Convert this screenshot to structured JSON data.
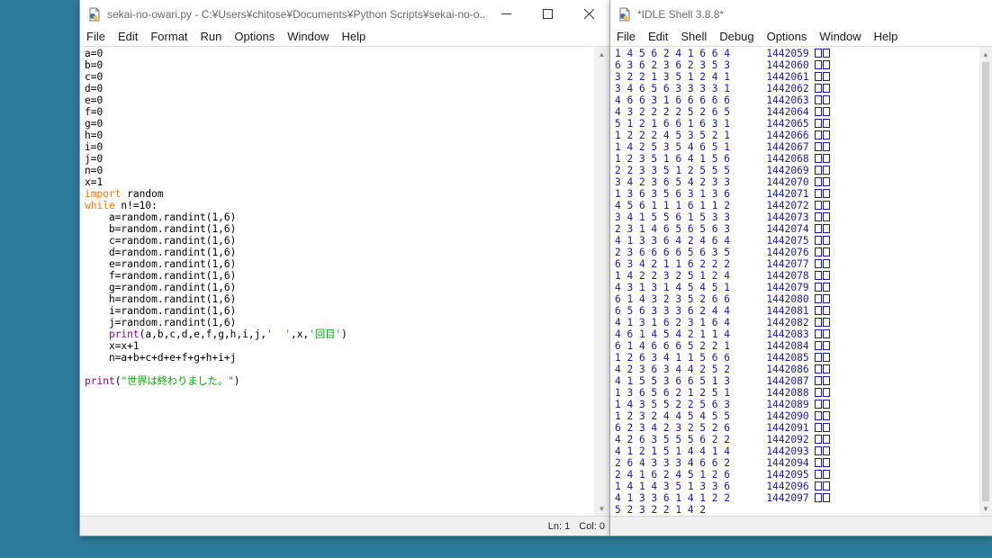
{
  "editor": {
    "title": "sekai-no-owari.py - C:¥Users¥chitose¥Documents¥Python Scripts¥sekai-no-o...",
    "menu": [
      "File",
      "Edit",
      "Format",
      "Run",
      "Options",
      "Window",
      "Help"
    ],
    "code_lines": [
      [
        [
          "n",
          "a=0"
        ]
      ],
      [
        [
          "n",
          "b=0"
        ]
      ],
      [
        [
          "n",
          "c=0"
        ]
      ],
      [
        [
          "n",
          "d=0"
        ]
      ],
      [
        [
          "n",
          "e=0"
        ]
      ],
      [
        [
          "n",
          "f=0"
        ]
      ],
      [
        [
          "n",
          "g=0"
        ]
      ],
      [
        [
          "n",
          "h=0"
        ]
      ],
      [
        [
          "n",
          "i=0"
        ]
      ],
      [
        [
          "n",
          "j=0"
        ]
      ],
      [
        [
          "n",
          "n=0"
        ]
      ],
      [
        [
          "n",
          "x=1"
        ]
      ],
      [
        [
          "kw",
          "import"
        ],
        [
          "n",
          " random"
        ]
      ],
      [
        [
          "kw",
          "while"
        ],
        [
          "n",
          " n!=10:"
        ]
      ],
      [
        [
          "n",
          "    a=random.randint(1,6)"
        ]
      ],
      [
        [
          "n",
          "    b=random.randint(1,6)"
        ]
      ],
      [
        [
          "n",
          "    c=random.randint(1,6)"
        ]
      ],
      [
        [
          "n",
          "    d=random.randint(1,6)"
        ]
      ],
      [
        [
          "n",
          "    e=random.randint(1,6)"
        ]
      ],
      [
        [
          "n",
          "    f=random.randint(1,6)"
        ]
      ],
      [
        [
          "n",
          "    g=random.randint(1,6)"
        ]
      ],
      [
        [
          "n",
          "    h=random.randint(1,6)"
        ]
      ],
      [
        [
          "n",
          "    i=random.randint(1,6)"
        ]
      ],
      [
        [
          "n",
          "    j=random.randint(1,6)"
        ]
      ],
      [
        [
          "n",
          "    "
        ],
        [
          "bi",
          "print"
        ],
        [
          "n",
          "(a,b,c,d,e,f,g,h,i,j,"
        ],
        [
          "str",
          "'  '"
        ],
        [
          "n",
          ",x,"
        ],
        [
          "str",
          "'回目'"
        ],
        [
          "n",
          ")"
        ]
      ],
      [
        [
          "n",
          "    x=x+1"
        ]
      ],
      [
        [
          "n",
          "    n=a+b+c+d+e+f+g+h+i+j"
        ]
      ],
      [
        [
          "n",
          ""
        ]
      ],
      [
        [
          "bi",
          "print"
        ],
        [
          "n",
          "("
        ],
        [
          "str",
          "\"世界は終わりました。\""
        ],
        [
          "n",
          ")"
        ]
      ]
    ],
    "status": {
      "ln": "Ln: 1",
      "col": "Col: 0"
    }
  },
  "shell": {
    "title": "*IDLE Shell 3.8.8*",
    "menu": [
      "File",
      "Edit",
      "Shell",
      "Debug",
      "Options",
      "Window",
      "Help"
    ],
    "output_lines": [
      {
        "digits": "1 4 5 6 2 4 1 6 6 4",
        "count": "1442059"
      },
      {
        "digits": "6 3 6 2 3 6 2 3 5 3",
        "count": "1442060"
      },
      {
        "digits": "3 2 2 1 3 5 1 2 4 1",
        "count": "1442061"
      },
      {
        "digits": "3 4 6 5 6 3 3 3 3 1",
        "count": "1442062"
      },
      {
        "digits": "4 6 6 3 1 6 6 6 6 6",
        "count": "1442063"
      },
      {
        "digits": "4 3 2 2 2 2 5 2 6 5",
        "count": "1442064"
      },
      {
        "digits": "5 1 2 1 6 6 1 6 3 1",
        "count": "1442065"
      },
      {
        "digits": "1 2 2 2 4 5 3 5 2 1",
        "count": "1442066"
      },
      {
        "digits": "1 4 2 5 3 5 4 6 5 1",
        "count": "1442067"
      },
      {
        "digits": "1 2 3 5 1 6 4 1 5 6",
        "count": "1442068"
      },
      {
        "digits": "2 2 3 3 5 1 2 5 5 5",
        "count": "1442069"
      },
      {
        "digits": "3 4 2 3 6 5 4 2 3 3",
        "count": "1442070"
      },
      {
        "digits": "1 3 6 3 5 6 3 1 3 6",
        "count": "1442071"
      },
      {
        "digits": "4 5 6 1 1 1 6 1 1 2",
        "count": "1442072"
      },
      {
        "digits": "3 4 1 5 5 6 1 5 3 3",
        "count": "1442073"
      },
      {
        "digits": "2 3 1 4 6 5 6 5 6 3",
        "count": "1442074"
      },
      {
        "digits": "4 1 3 3 6 4 2 4 6 4",
        "count": "1442075"
      },
      {
        "digits": "2 3 6 6 6 6 5 6 3 5",
        "count": "1442076"
      },
      {
        "digits": "6 3 4 2 1 1 6 2 2 2",
        "count": "1442077"
      },
      {
        "digits": "1 4 2 2 3 2 5 1 2 4",
        "count": "1442078"
      },
      {
        "digits": "4 3 1 3 1 4 5 4 5 1",
        "count": "1442079"
      },
      {
        "digits": "6 1 4 3 2 3 5 2 6 6",
        "count": "1442080"
      },
      {
        "digits": "6 5 6 3 3 3 6 2 4 4",
        "count": "1442081"
      },
      {
        "digits": "4 1 3 1 6 2 3 1 6 4",
        "count": "1442082"
      },
      {
        "digits": "4 6 1 4 5 4 2 1 1 4",
        "count": "1442083"
      },
      {
        "digits": "6 1 4 6 6 6 5 2 2 1",
        "count": "1442084"
      },
      {
        "digits": "1 2 6 3 4 1 1 5 6 6",
        "count": "1442085"
      },
      {
        "digits": "4 2 3 6 3 4 4 2 5 2",
        "count": "1442086"
      },
      {
        "digits": "4 1 5 5 3 6 6 5 1 3",
        "count": "1442087"
      },
      {
        "digits": "1 3 6 5 6 2 1 2 5 1",
        "count": "1442088"
      },
      {
        "digits": "1 4 3 5 5 2 2 5 6 3",
        "count": "1442089"
      },
      {
        "digits": "1 2 3 2 4 4 5 4 5 5",
        "count": "1442090"
      },
      {
        "digits": "6 2 3 4 2 3 2 5 2 6",
        "count": "1442091"
      },
      {
        "digits": "4 2 6 3 5 5 5 6 2 2",
        "count": "1442092"
      },
      {
        "digits": "4 1 2 1 5 1 4 4 1 4",
        "count": "1442093"
      },
      {
        "digits": "2 6 4 3 3 3 4 6 6 2",
        "count": "1442094"
      },
      {
        "digits": "2 4 1 6 2 4 5 1 2 6",
        "count": "1442095"
      },
      {
        "digits": "1 4 1 4 3 5 1 3 3 6",
        "count": "1442096"
      },
      {
        "digits": "4 1 3 3 6 1 4 1 2 2",
        "count": "1442097"
      },
      {
        "digits": "5 2 3 2 2 1 4 2",
        "count": ""
      }
    ]
  }
}
